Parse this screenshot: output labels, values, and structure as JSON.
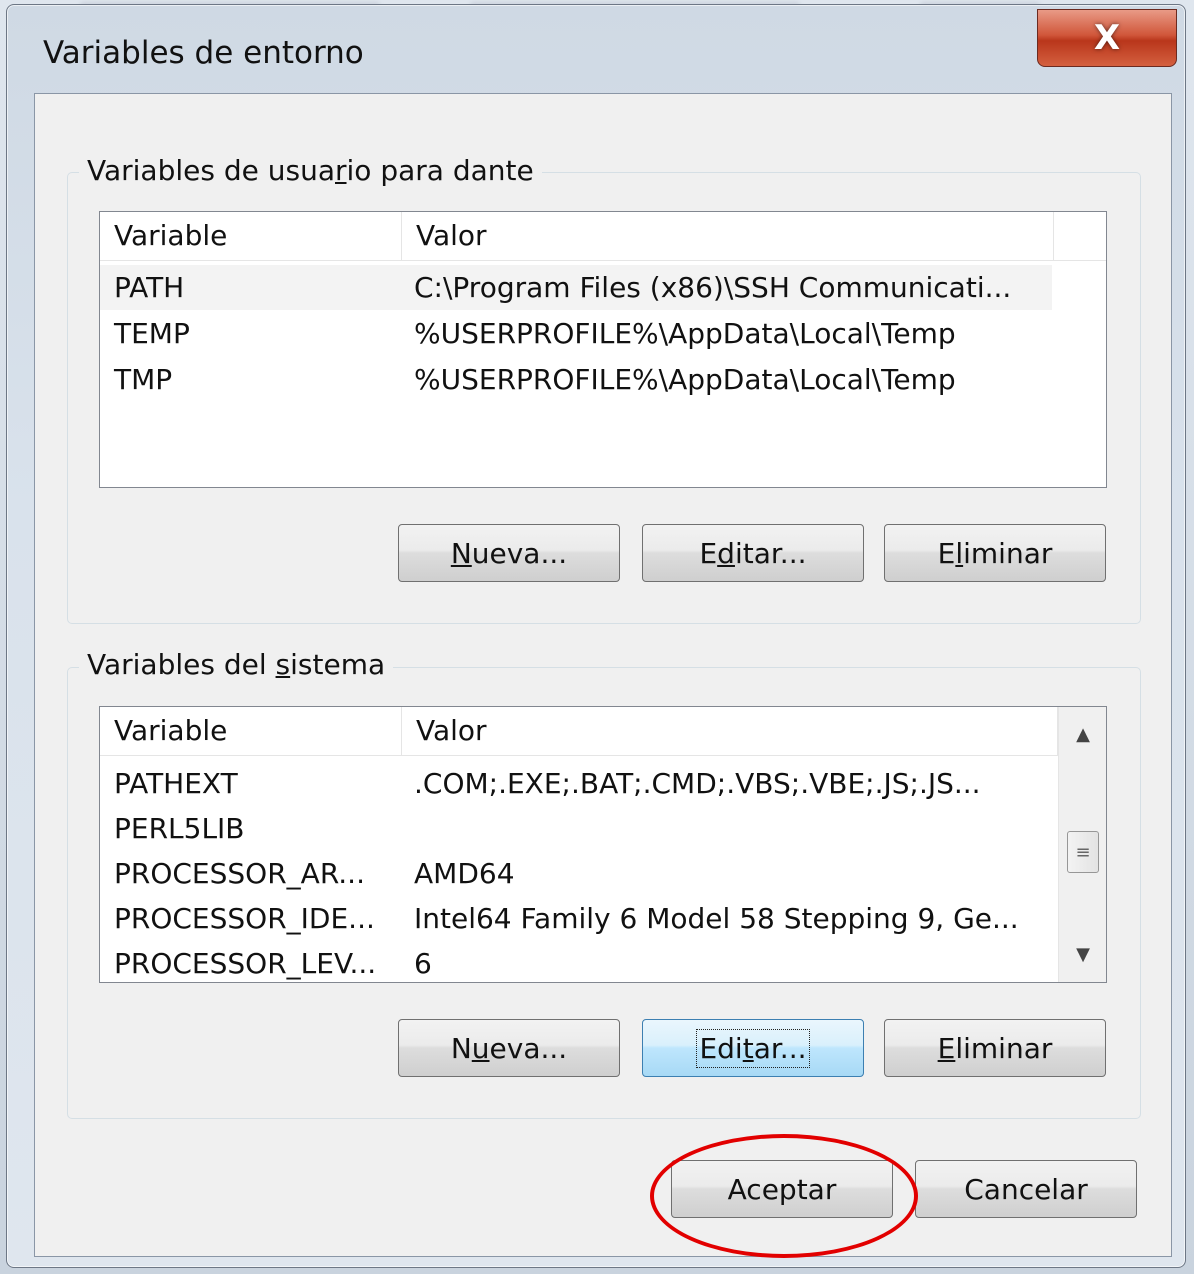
{
  "window": {
    "title": "Variables de entorno",
    "close_glyph": "X"
  },
  "user_group": {
    "title_pre": "Variables de usua",
    "title_accel": "r",
    "title_post": "io para dante",
    "columns": [
      "Variable",
      "Valor"
    ],
    "rows": [
      {
        "variable": "PATH",
        "value": "C:\\Program Files (x86)\\SSH Communicati..."
      },
      {
        "variable": "TEMP",
        "value": "%USERPROFILE%\\AppData\\Local\\Temp"
      },
      {
        "variable": "TMP",
        "value": "%USERPROFILE%\\AppData\\Local\\Temp"
      }
    ],
    "buttons": {
      "new": {
        "pre": "",
        "accel": "N",
        "post": "ueva..."
      },
      "edit": {
        "pre": "E",
        "accel": "d",
        "post": "itar..."
      },
      "delete": {
        "pre": "E",
        "accel": "l",
        "post": "iminar"
      }
    }
  },
  "system_group": {
    "title_pre": "Variables del ",
    "title_accel": "s",
    "title_post": "istema",
    "columns": [
      "Variable",
      "Valor"
    ],
    "rows": [
      {
        "variable": "PATHEXT",
        "value": ".COM;.EXE;.BAT;.CMD;.VBS;.VBE;.JS;.JS..."
      },
      {
        "variable": "PERL5LIB",
        "value": ""
      },
      {
        "variable": "PROCESSOR_AR...",
        "value": "AMD64"
      },
      {
        "variable": "PROCESSOR_IDE...",
        "value": "Intel64 Family 6 Model 58 Stepping 9, Ge..."
      },
      {
        "variable": "PROCESSOR_LEV...",
        "value": "6"
      }
    ],
    "buttons": {
      "new": {
        "pre": "N",
        "accel": "u",
        "post": "eva..."
      },
      "edit": {
        "pre": "Edi",
        "accel": "t",
        "post": "ar..."
      },
      "delete": {
        "pre": "",
        "accel": "E",
        "post": "liminar"
      }
    }
  },
  "footer": {
    "ok_label": "Aceptar",
    "cancel_label": "Cancelar"
  },
  "icons": {
    "scroll_up": "▲",
    "scroll_down": "▼",
    "thumb_grip": "≡"
  },
  "colors": {
    "close_button": "#c7472a",
    "annotation_ellipse": "#e20000"
  }
}
